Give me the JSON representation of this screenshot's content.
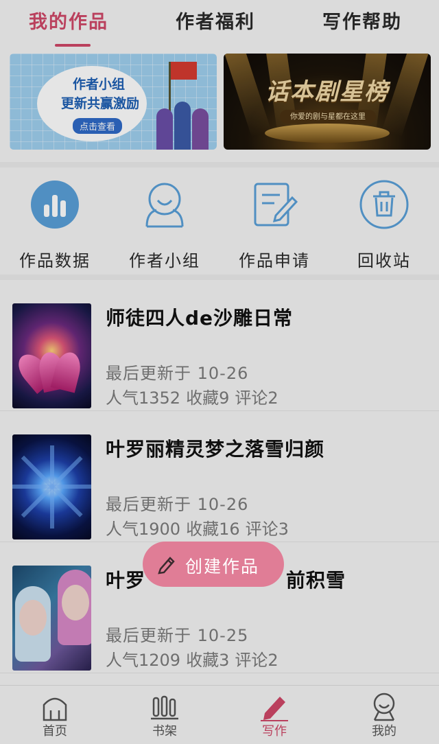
{
  "tabs": {
    "items": [
      "我的作品",
      "作者福利",
      "写作帮助"
    ],
    "active": "我的作品"
  },
  "banners": {
    "left": {
      "title": "作者小组",
      "subtitle": "更新共赢激励",
      "button": "点击查看"
    },
    "right": {
      "title": "话本剧星榜",
      "subtitle": "你爱的剧与星都在这里"
    }
  },
  "tools": [
    {
      "label": "作品数据",
      "icon": "bar-chart-icon"
    },
    {
      "label": "作者小组",
      "icon": "group-avatar-icon"
    },
    {
      "label": "作品申请",
      "icon": "edit-document-icon"
    },
    {
      "label": "回收站",
      "icon": "trash-icon"
    }
  ],
  "works": [
    {
      "title": "师徒四人de沙雕日常",
      "updated": "最后更新于 10-26",
      "popularity": "人气1352",
      "favorites": "收藏9",
      "comments": "评论2"
    },
    {
      "title": "叶罗丽精灵梦之落雪归颜",
      "updated": "最后更新于 10-26",
      "popularity": "人气1900",
      "favorites": "收藏16",
      "comments": "评论3"
    },
    {
      "title": "叶罗",
      "title_tail": "前积雪",
      "updated": "最后更新于 10-25",
      "popularity": "人气1209",
      "favorites": "收藏3",
      "comments": "评论2"
    }
  ],
  "fab": {
    "label": "创建作品",
    "icon": "pencil-icon"
  },
  "bottom_nav": [
    {
      "label": "首页",
      "icon": "home-icon"
    },
    {
      "label": "书架",
      "icon": "bookshelf-icon"
    },
    {
      "label": "写作",
      "icon": "pencil-icon",
      "active": true
    },
    {
      "label": "我的",
      "icon": "profile-icon"
    }
  ],
  "colors": {
    "accent": "#d04868",
    "fab": "#e07d96",
    "icon_blue": "#5aa0d8"
  }
}
